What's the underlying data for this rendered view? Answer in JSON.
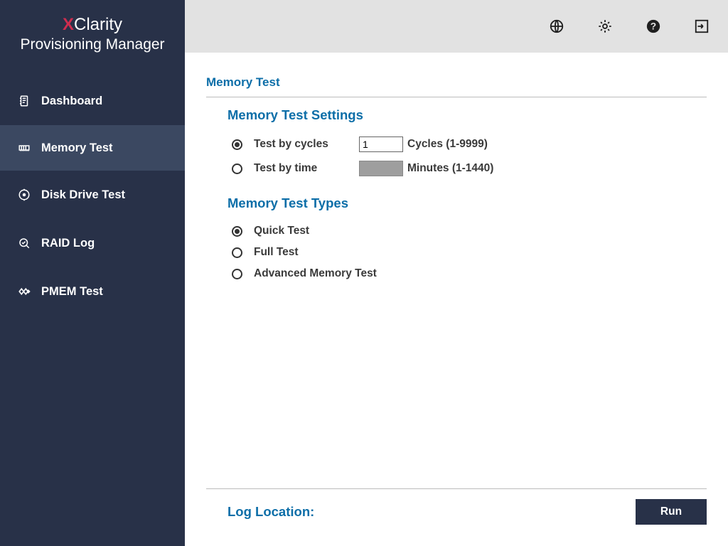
{
  "logo": {
    "prefix_x": "X",
    "top_rest": "Clarity",
    "bottom": "Provisioning Manager"
  },
  "sidebar": {
    "items": [
      {
        "id": "dashboard",
        "label": "Dashboard",
        "active": false
      },
      {
        "id": "memory-test",
        "label": "Memory Test",
        "active": true
      },
      {
        "id": "disk-drive-test",
        "label": "Disk Drive Test",
        "active": false
      },
      {
        "id": "raid-log",
        "label": "RAID Log",
        "active": false
      },
      {
        "id": "pmem-test",
        "label": "PMEM Test",
        "active": false
      }
    ]
  },
  "topbar": {
    "icons": [
      "globe",
      "gear",
      "help",
      "exit"
    ]
  },
  "page": {
    "title": "Memory Test",
    "settings_title": "Memory Test Settings",
    "test_by_cycles_label": "Test by cycles",
    "test_by_time_label": "Test by time",
    "cycles_value": "1",
    "cycles_hint": "Cycles  (1-9999)",
    "minutes_value": "",
    "minutes_hint": "Minutes (1-1440)",
    "types_title": "Memory Test Types",
    "quick_test_label": "Quick Test",
    "full_test_label": "Full Test",
    "advanced_test_label": "Advanced Memory Test",
    "log_location_label": "Log Location:",
    "run_button": "Run"
  }
}
